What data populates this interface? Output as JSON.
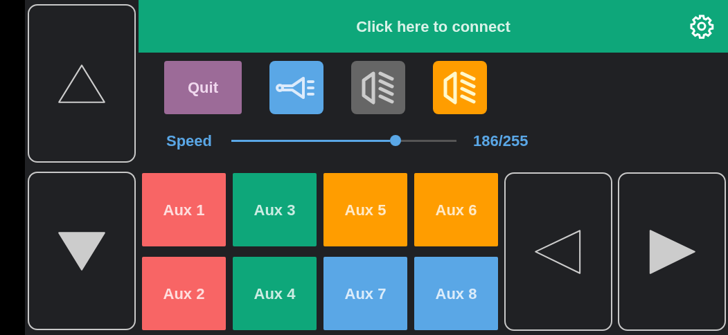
{
  "header": {
    "title": "Click here to connect"
  },
  "direction_buttons": [
    {
      "kind": "up",
      "filled": false
    },
    {
      "kind": "down",
      "filled": true
    },
    {
      "kind": "left",
      "filled": false
    },
    {
      "kind": "right",
      "filled": true
    }
  ],
  "quit_button": {
    "label": "Quit"
  },
  "icon_buttons": [
    {
      "kind": "horn",
      "on": true
    },
    {
      "kind": "lights",
      "on": false
    },
    {
      "kind": "lights",
      "on": true
    }
  ],
  "speed": {
    "label": "Speed",
    "level": 0.729,
    "reading": "186/255"
  },
  "aux_buttons": [
    {
      "label": "Aux 1",
      "color": "#f86565"
    },
    {
      "label": "Aux 3",
      "color": "#0ea77a"
    },
    {
      "label": "Aux 5",
      "color": "#ff9d00"
    },
    {
      "label": "Aux 6",
      "color": "#ff9d00"
    },
    {
      "label": "Aux 2",
      "color": "#f86565"
    },
    {
      "label": "Aux 4",
      "color": "#0ea77a"
    },
    {
      "label": "Aux 7",
      "color": "#5aa7e6"
    },
    {
      "label": "Aux 8",
      "color": "#5aa7e6"
    }
  ]
}
